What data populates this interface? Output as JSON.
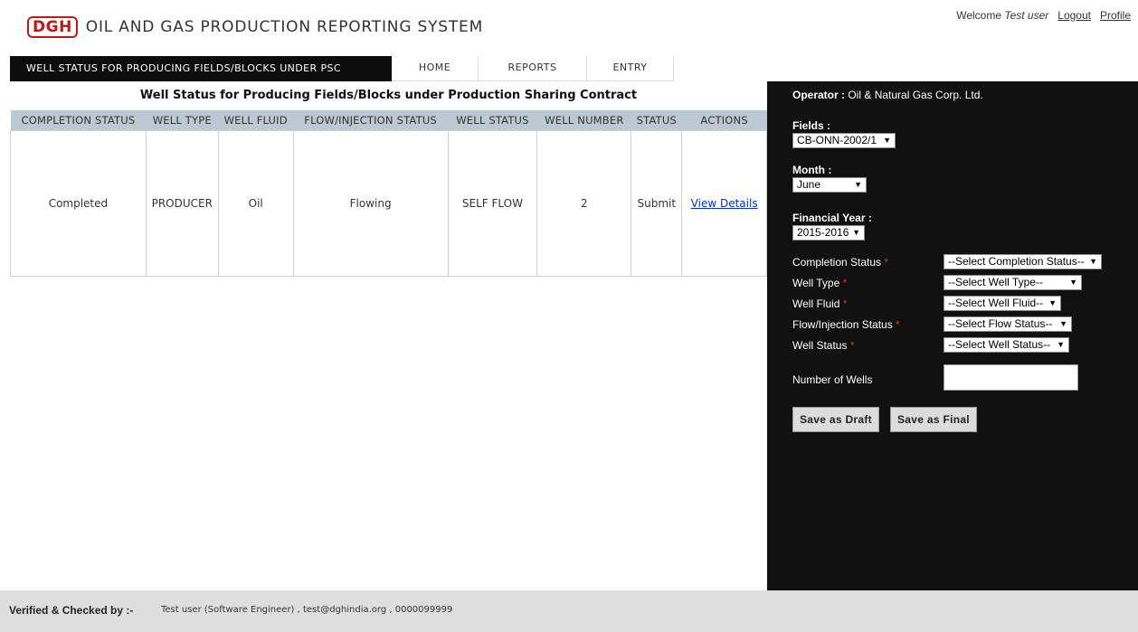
{
  "header": {
    "logo": "DGH",
    "title": "OIL AND GAS PRODUCTION REPORTING SYSTEM",
    "welcome_prefix": "Welcome ",
    "user": "Test user",
    "logout": "Logout",
    "profile": "Profile"
  },
  "nav": {
    "title": "WELL STATUS FOR PRODUCING FIELDS/BLOCKS UNDER PSC",
    "items": [
      "HOME",
      "REPORTS",
      "ENTRY"
    ]
  },
  "table": {
    "heading": "Well Status for Producing Fields/Blocks under Production Sharing Contract",
    "columns": [
      "COMPLETION STATUS",
      "WELL TYPE",
      "WELL FLUID",
      "FLOW/INJECTION STATUS",
      "WELL STATUS",
      "WELL NUMBER",
      "STATUS",
      "ACTIONS"
    ],
    "rows": [
      {
        "completion_status": "Completed",
        "well_type": "PRODUCER",
        "well_fluid": "Oil",
        "flow_status": "Flowing",
        "well_status": "SELF FLOW",
        "well_number": "2",
        "status": "Submit",
        "action": "View Details"
      }
    ]
  },
  "side": {
    "operator_label": "Operator :",
    "operator_value": " Oil & Natural Gas Corp. Ltd.",
    "fields_label": "Fields :",
    "fields_value": "CB-ONN-2002/1",
    "month_label": "Month :",
    "month_value": "June",
    "fy_label": "Financial Year :",
    "fy_value": "2015-2016",
    "form": {
      "completion_label": "Completion Status",
      "completion_placeholder": "--Select Completion Status--",
      "well_type_label": "Well Type",
      "well_type_placeholder": "--Select Well Type--",
      "well_fluid_label": "Well Fluid",
      "well_fluid_placeholder": "--Select Well Fluid--",
      "flow_label": "Flow/Injection Status",
      "flow_placeholder": "--Select Flow Status--",
      "well_status_label": "Well Status",
      "well_status_placeholder": "--Select Well Status--",
      "num_wells_label": "Number of Wells",
      "num_wells_value": "",
      "required_mark": "*"
    },
    "save_draft": "Save as Draft",
    "save_final": "Save as Final"
  },
  "footer": {
    "label": "Verified & Checked by :-",
    "value": "Test user (Software Engineer) , test@dghindia.org , 0000099999"
  }
}
